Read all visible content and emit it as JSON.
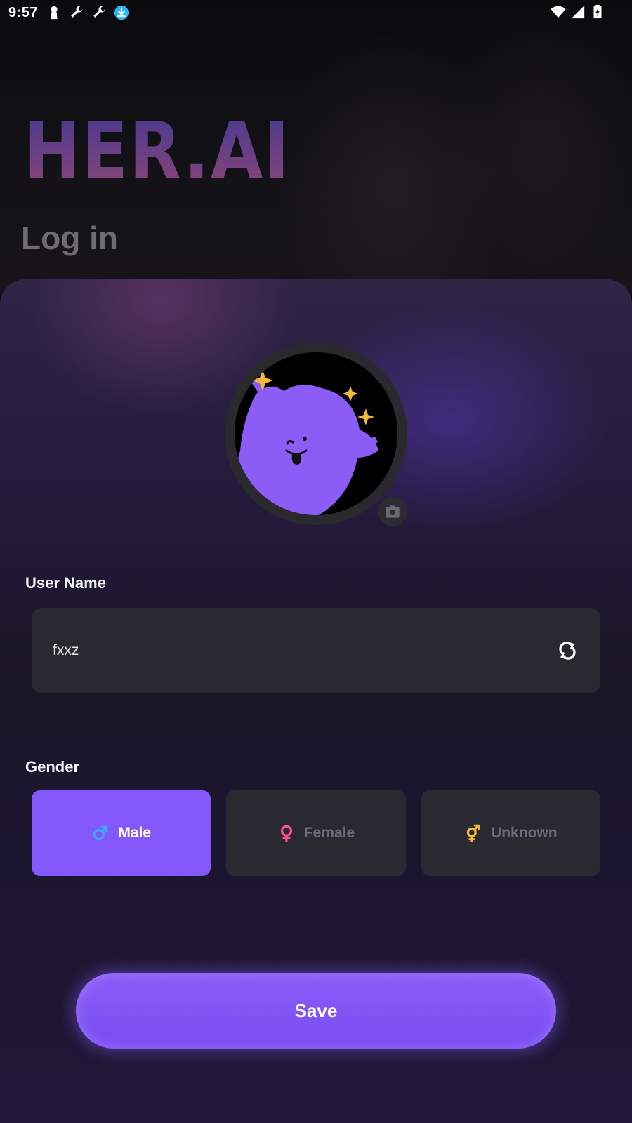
{
  "status_bar": {
    "time": "9:57",
    "left_icons": [
      "keyhole-icon",
      "wrench-icon",
      "wrench-icon",
      "download-icon"
    ],
    "right_icons": [
      "wifi-icon",
      "signal-icon",
      "battery-charging-icon"
    ]
  },
  "header": {
    "logo_text": "HER.AI",
    "title": "Log in"
  },
  "profile": {
    "avatar_icon": "purple-blob-avatar",
    "camera_icon": "camera-icon"
  },
  "form": {
    "username_label": "User Name",
    "username_value": "fxxz",
    "refresh_icon": "refresh-icon",
    "gender_label": "Gender",
    "gender_options": [
      {
        "label": "Male",
        "icon": "male-symbol-icon",
        "icon_color": "#3aa8ff",
        "selected": true
      },
      {
        "label": "Female",
        "icon": "female-symbol-icon",
        "icon_color": "#ff4f8f",
        "selected": false
      },
      {
        "label": "Unknown",
        "icon": "transgender-symbol-icon",
        "icon_color": "#f5b73b",
        "selected": false
      }
    ],
    "save_label": "Save"
  },
  "colors": {
    "accent": "#8558fb",
    "field_bg": "#2a2830",
    "muted_text": "#6f6b7e"
  }
}
